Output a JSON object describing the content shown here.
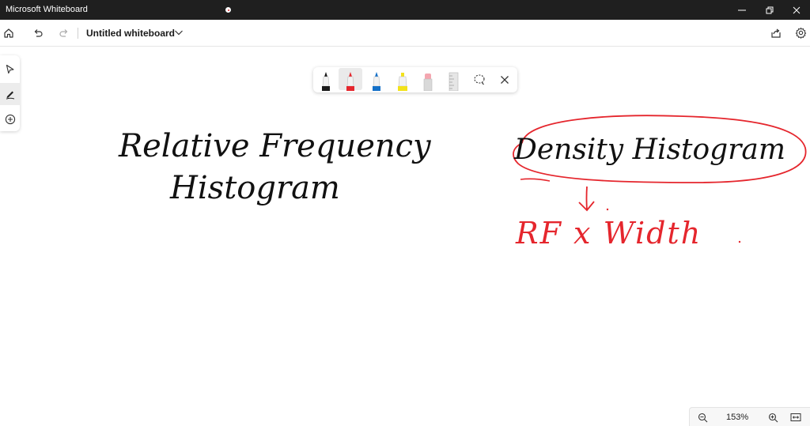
{
  "titlebar": {
    "app_title": "Microsoft Whiteboard",
    "recording_indicator_color": "#d9252a",
    "minimize_icon": "minimize-icon",
    "restore_icon": "restore-icon",
    "close_icon": "close-icon"
  },
  "header": {
    "board_title": "Untitled whiteboard",
    "home_icon": "home-icon",
    "undo_icon": "undo-icon",
    "redo_icon": "redo-icon",
    "share_icon": "share-icon",
    "settings_icon": "gear-icon"
  },
  "left_toolbar": {
    "items": [
      {
        "name": "select-tool",
        "icon": "pointer-icon",
        "active": false
      },
      {
        "name": "ink-tool",
        "icon": "pen-icon",
        "active": true
      },
      {
        "name": "add-tool",
        "icon": "plus-circle-icon",
        "active": false
      }
    ]
  },
  "ink_toolbar": {
    "pens": [
      {
        "name": "black-pen",
        "color": "#1a1a1a",
        "selected": false
      },
      {
        "name": "red-pen",
        "color": "#e5262d",
        "selected": true
      },
      {
        "name": "blue-pen",
        "color": "#1470c8",
        "selected": false
      },
      {
        "name": "yellow-highlighter",
        "color": "#f3e21a",
        "selected": false
      },
      {
        "name": "eraser",
        "color": "#f4a6b0",
        "selected": false
      },
      {
        "name": "ruler",
        "color": "#cfcfcf",
        "selected": false
      }
    ],
    "lasso_icon": "lasso-icon",
    "close_icon": "close-icon"
  },
  "canvas": {
    "ink_black": {
      "line1": "Relative Frequency",
      "line2": "Histogram"
    },
    "ink_red": {
      "circled": "Density Histogram",
      "formula": "RF x Width"
    },
    "ink_colors": {
      "black": "#111111",
      "red": "#e5262d"
    }
  },
  "zoom": {
    "level": "153%",
    "zoom_out_icon": "zoom-out-icon",
    "zoom_in_icon": "zoom-in-icon",
    "fit_icon": "fit-to-screen-icon"
  }
}
